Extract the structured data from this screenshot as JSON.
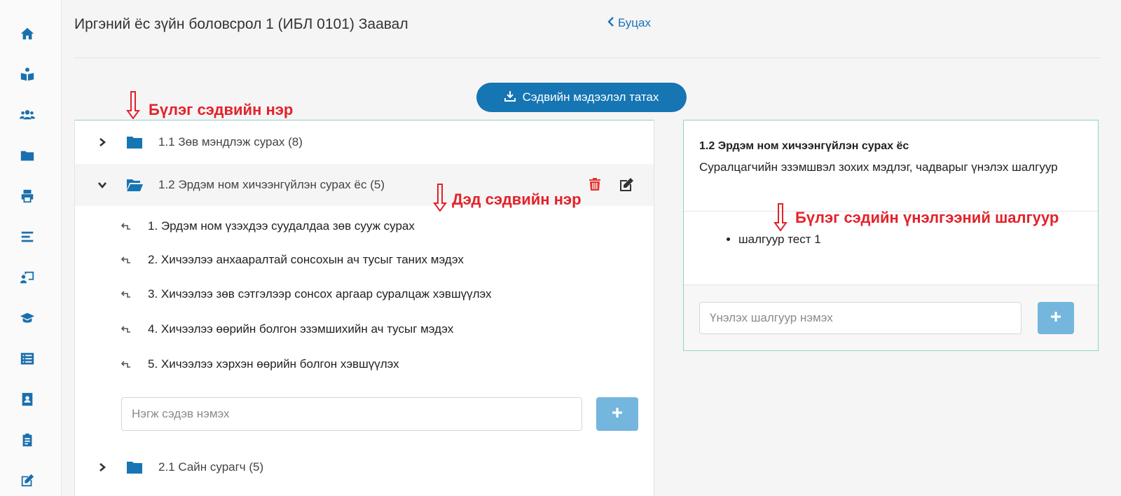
{
  "sidebar": {
    "icons": [
      {
        "name": "home-icon"
      },
      {
        "name": "book-reader-icon"
      },
      {
        "name": "users-icon"
      },
      {
        "name": "folder-icon"
      },
      {
        "name": "printer-icon"
      },
      {
        "name": "align-icon"
      },
      {
        "name": "chalkboard-teacher-icon"
      },
      {
        "name": "graduation-cap-icon"
      },
      {
        "name": "list-icon"
      },
      {
        "name": "address-book-icon"
      },
      {
        "name": "clipboard-icon"
      },
      {
        "name": "edit-icon"
      }
    ]
  },
  "header": {
    "title": "Иргэний ёс зүйн боловсрол 1 (ИБЛ 0101) Заавал",
    "back_label": "Буцах"
  },
  "download_label": "Сэдвийн мэдээлэл татах",
  "tree": {
    "folders": [
      {
        "label": "1.1 Зөв мэндлэж сурах (8)"
      },
      {
        "label": "1.2 Эрдэм ном хичээнгүйлэн сурах ёс (5)"
      },
      {
        "label": "2.1 Сайн сурагч (5)"
      }
    ],
    "topics": [
      "1. Эрдэм ном үзэхдээ суудалдаа зөв сууж сурах",
      "2. Хичээлээ анхааралтай сонсохын ач тусыг таних мэдэх",
      "3. Хичээлээ зөв сэтгэлээр сонсох аргаар суралцаж хэвшүүлэх",
      "4. Хичээлээ өөрийн болгон эзэмшихийн ач тусыг мэдэх",
      "5. Хичээлээ хэрхэн өөрийн болгон хэвшүүлэх"
    ],
    "topic_input_placeholder": "Нэгж сэдэв нэмэх"
  },
  "detail": {
    "title": "1.2 Эрдэм ном хичээнгүйлэн сурах ёс",
    "description": "Суралцагчийн эзэмшвэл зохих мэдлэг, чадварыг үнэлэх шалгуур",
    "criteria": [
      "шалгуур тест 1"
    ],
    "criteria_input_placeholder": "Үнэлэх шалгуур нэмэх"
  },
  "annotations": {
    "group_name": "Бүлэг сэдвийн нэр",
    "subtopic_name": "Дэд сэдвийн нэр",
    "group_criteria": "Бүлэг сэдийн үнэлгээний шалгуур"
  },
  "colors": {
    "primary": "#1675b3",
    "add_button": "#74b6dd",
    "danger": "#e3342f",
    "annotation": "#e3222a",
    "panel_border": "#8fd3c4"
  }
}
